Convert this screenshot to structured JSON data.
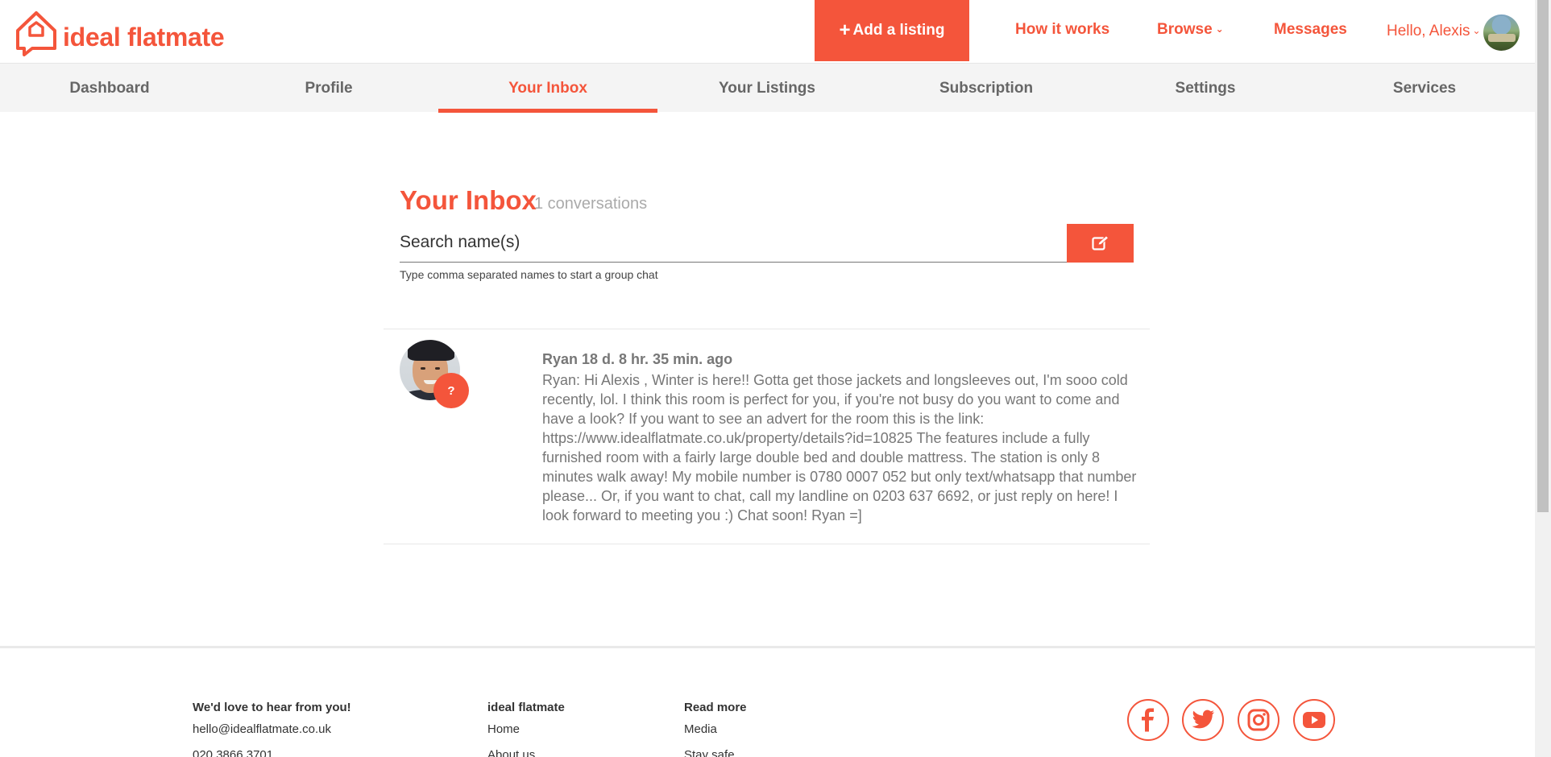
{
  "header": {
    "logo_text": "ideal flatmate",
    "add_listing_label": "Add a listing",
    "nav": [
      {
        "label": "How it works"
      },
      {
        "label": "Browse"
      },
      {
        "label": "Messages"
      }
    ],
    "greeting": "Hello, Alexis"
  },
  "tabs": [
    {
      "label": "Dashboard"
    },
    {
      "label": "Profile"
    },
    {
      "label": "Your Inbox",
      "active": true
    },
    {
      "label": "Your Listings"
    },
    {
      "label": "Subscription"
    },
    {
      "label": "Settings"
    },
    {
      "label": "Services"
    }
  ],
  "inbox": {
    "title": "Your Inbox",
    "count_text": "1 conversations",
    "search_placeholder": "Search name(s)",
    "hint": "Type comma separated names to start a group chat"
  },
  "conversations": [
    {
      "header": "Ryan 18 d. 8 hr. 35 min. ago",
      "badge": "?",
      "message": "Ryan: Hi Alexis , Winter is here!! Gotta get those jackets and longsleeves out, I'm sooo cold recently, lol. I think this room is perfect for you, if you're not busy do you want to come and have a look? If you want to see an advert for the room this is the link: https://www.idealflatmate.co.uk/property/details?id=10825 The features include a fully furnished room with a fairly large double bed and double mattress. The station is only 8 minutes walk away! My mobile number is 0780 0007 052 but only text/whatsapp that number please... Or, if you want to chat, call my landline on 0203 637 6692, or just reply on here! I look forward to meeting you :) Chat soon! Ryan =]"
    }
  ],
  "footer": {
    "contact": {
      "heading": "We'd love to hear from you!",
      "email": "hello@idealflatmate.co.uk",
      "phone": "020 3866 3701"
    },
    "company": {
      "heading": "ideal flatmate",
      "links": [
        "Home",
        "About us"
      ]
    },
    "read_more": {
      "heading": "Read more",
      "links": [
        "Media",
        "Stay safe"
      ]
    },
    "social": [
      "facebook-icon",
      "twitter-icon",
      "instagram-icon",
      "youtube-icon"
    ]
  },
  "colors": {
    "accent": "#f4553b",
    "text_muted": "#777777",
    "subnav_bg": "#f4f4f4"
  }
}
